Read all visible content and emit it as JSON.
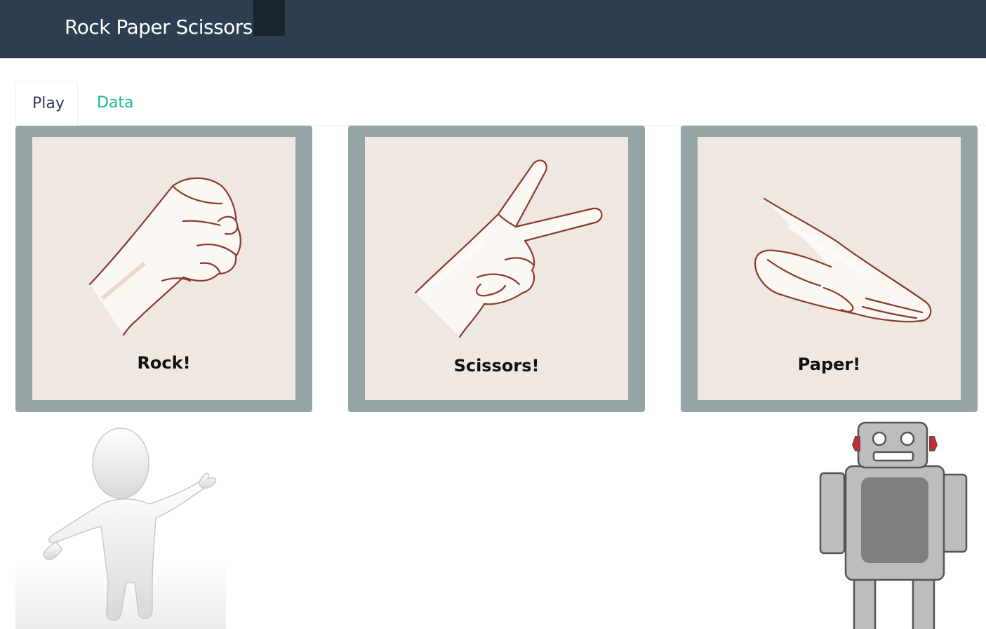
{
  "navbar": {
    "title": "Rock Paper Scissors"
  },
  "tabs": [
    {
      "label": "Play",
      "active": true
    },
    {
      "label": "Data",
      "active": false
    }
  ],
  "choices": [
    {
      "label": "Rock!",
      "icon": "rock-hand-icon"
    },
    {
      "label": "Scissors!",
      "icon": "scissors-hand-icon"
    },
    {
      "label": "Paper!",
      "icon": "paper-hand-icon"
    }
  ],
  "players": {
    "human_icon": "human-figure-icon",
    "robot_icon": "robot-icon"
  },
  "colors": {
    "navbar": "#2c3e50",
    "accent": "#18bc9c",
    "card_frame": "#95a5a6",
    "card_bg": "#efe7e1",
    "robot_ears": "#e0202a"
  }
}
